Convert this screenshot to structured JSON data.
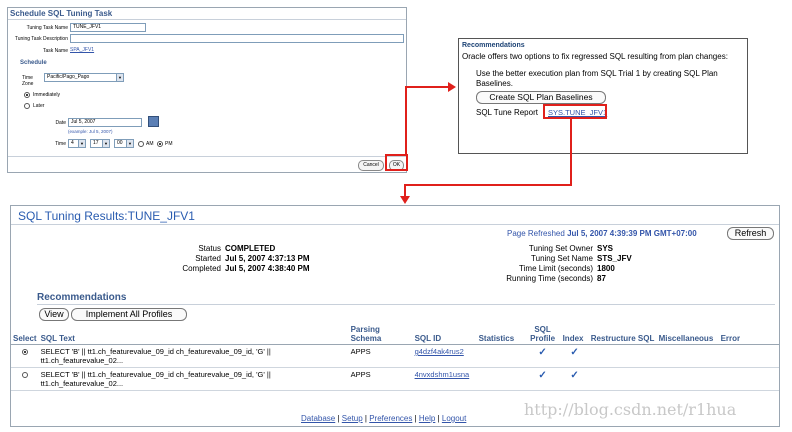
{
  "schedule_task": {
    "title": "Schedule SQL Tuning Task",
    "task_name_label": "Tuning Task Name",
    "task_name_value": "TUNE_JFV1",
    "task_desc_label": "Tuning Task Description",
    "task_desc_value": "",
    "task_label": "Task Name",
    "task_value": "SPA_JFV1",
    "schedule_heading": "Schedule",
    "timezone_label": "Time Zone",
    "timezone_value": "Pacific/Pago_Pago",
    "immediately_label": "Immediately",
    "later_label": "Later",
    "date_label": "Date",
    "date_value": "Jul 5, 2007",
    "date_example": "(example: Jul 5, 2007)",
    "time_label": "Time",
    "time_hour": "4",
    "time_minute": "17",
    "time_second": "00",
    "am_label": "AM",
    "pm_label": "PM",
    "cancel_label": "Cancel",
    "ok_label": "OK"
  },
  "recommendations_panel": {
    "title": "Recommendations",
    "intro": "Oracle offers two options to fix regressed SQL resulting from plan changes:",
    "option_text_1": "Use the better execution plan from SQL Trial 1 by creating SQL Plan",
    "option_text_2": "Baselines.",
    "create_button": "Create SQL Plan Baselines",
    "report_label": "SQL Tune Report",
    "report_link": "SYS.TUNE_JFV1"
  },
  "results": {
    "title": "SQL Tuning Results:TUNE_JFV1",
    "page_refreshed_label": "Page Refreshed",
    "page_refreshed_value": "Jul 5, 2007 4:39:39 PM GMT+07:00",
    "refresh_button": "Refresh",
    "status_label": "Status",
    "status_value": "COMPLETED",
    "started_label": "Started",
    "started_value": "Jul 5, 2007 4:37:13 PM",
    "completed_label": "Completed",
    "completed_value": "Jul 5, 2007 4:38:40 PM",
    "owner_label": "Tuning Set Owner",
    "owner_value": "SYS",
    "setname_label": "Tuning Set Name",
    "setname_value": "STS_JFV",
    "timelimit_label": "Time Limit (seconds)",
    "timelimit_value": "1800",
    "runtime_label": "Running Time (seconds)",
    "runtime_value": "87",
    "recs_heading": "Recommendations",
    "view_button": "View",
    "implement_button": "Implement All Profiles",
    "columns": [
      "Select",
      "SQL Text",
      "Parsing Schema",
      "SQL ID",
      "Statistics",
      "SQL Profile",
      "Index",
      "Restructure SQL",
      "Miscellaneous",
      "Error"
    ],
    "rows": [
      {
        "selected": true,
        "sql_text_1": "SELECT 'B' || tt1.ch_featurevalue_09_id ch_featurevalue_09_id, 'G' ||",
        "sql_text_2": "tt1.ch_featurevalue_02...",
        "schema": "APPS",
        "sql_id": "g4dzf4ak4rus2",
        "profile": "✓",
        "index": "✓"
      },
      {
        "selected": false,
        "sql_text_1": "SELECT 'B' || tt1.ch_featurevalue_09_id ch_featurevalue_09_id, 'G' ||",
        "sql_text_2": "tt1.ch_featurevalue_02...",
        "schema": "APPS",
        "sql_id": "4nvxdshm1usna",
        "profile": "✓",
        "index": "✓"
      }
    ],
    "footer_links": [
      "Database",
      "Setup",
      "Preferences",
      "Help",
      "Logout"
    ],
    "watermark": "http://blog.csdn.net/r1hua"
  },
  "colors": {
    "heading_blue": "#3a5a8c",
    "link_blue": "#3355aa",
    "connector_red": "#e0201b"
  }
}
